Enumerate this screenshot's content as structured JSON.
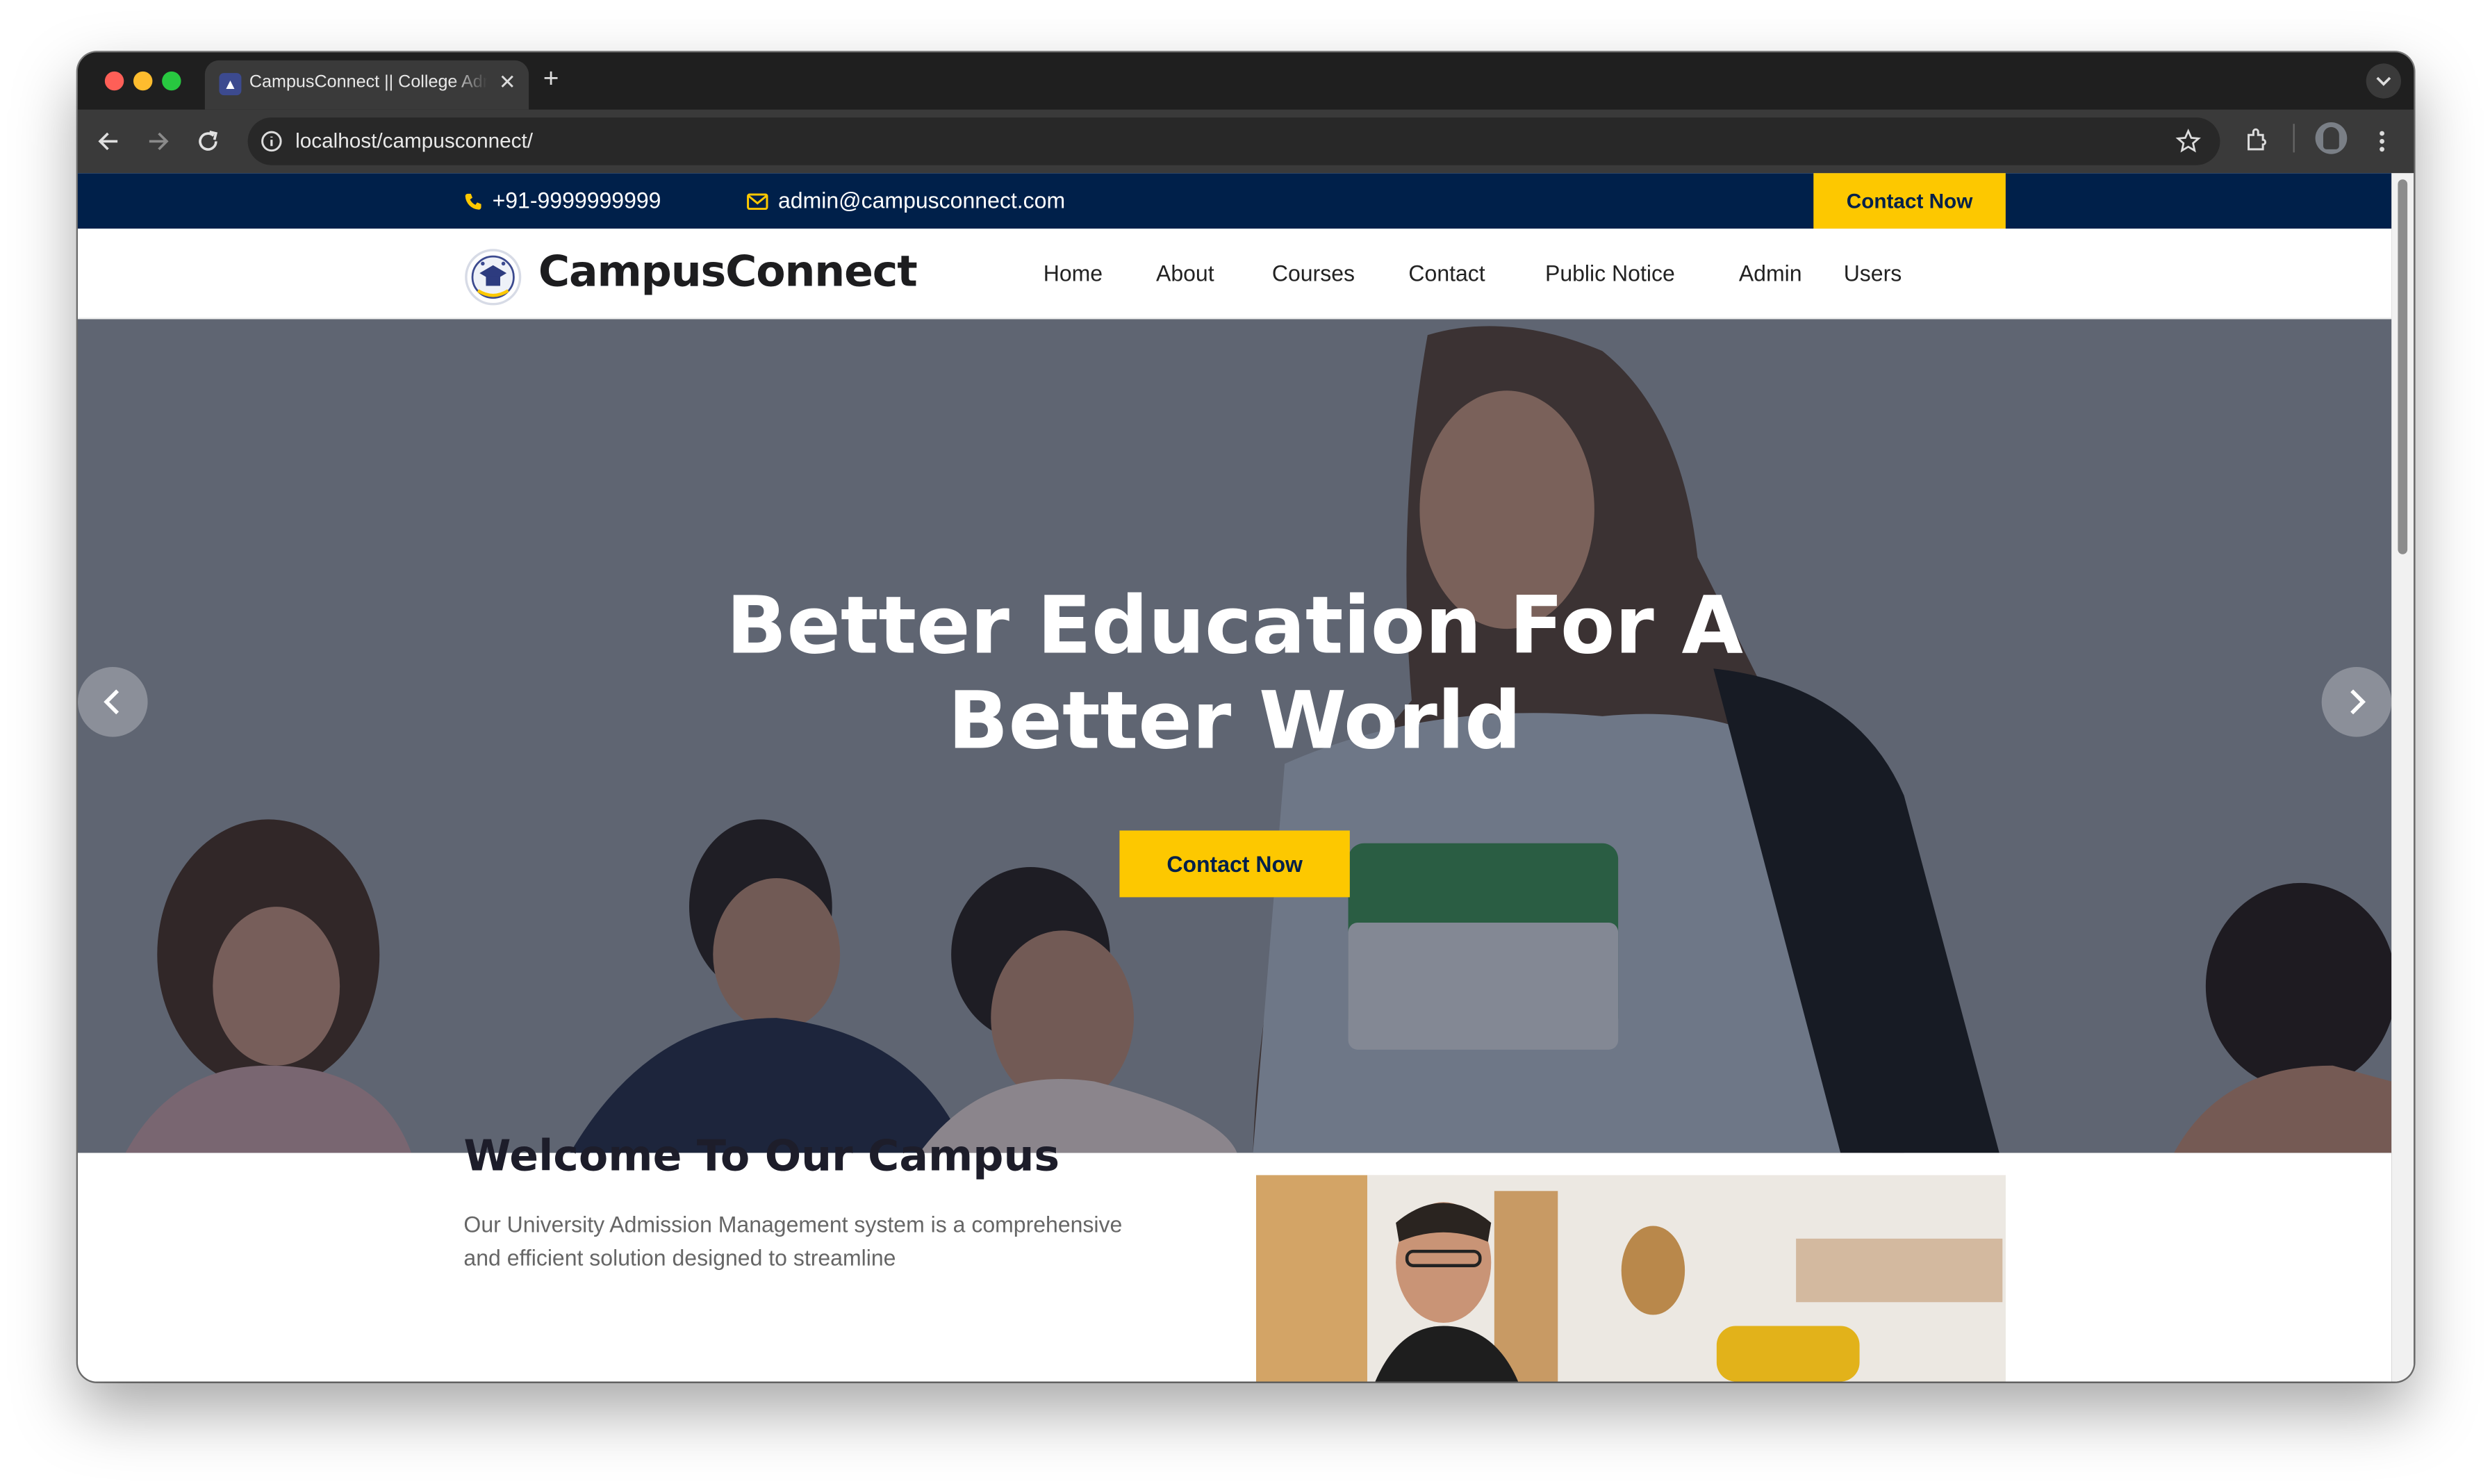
{
  "browser": {
    "tab_title": "CampusConnect || College Admission",
    "url": "localhost/campusconnect/"
  },
  "topbar": {
    "phone": "+91-9999999999",
    "email": "admin@campusconnect.com",
    "cta": "Contact Now"
  },
  "navbar": {
    "brand": "CampusConnect",
    "items": [
      "Home",
      "About",
      "Courses",
      "Contact",
      "Public Notice",
      "Admin",
      "Users"
    ]
  },
  "hero": {
    "title_line1": "Better Education For A",
    "title_line2": "Better World",
    "cta": "Contact Now"
  },
  "welcome": {
    "title": "Welcome To Our Campus",
    "body": "Our University Admission Management system is a comprehensive and efficient solution designed to streamline"
  },
  "colors": {
    "accent": "#fdc800",
    "navy": "#00204a"
  }
}
